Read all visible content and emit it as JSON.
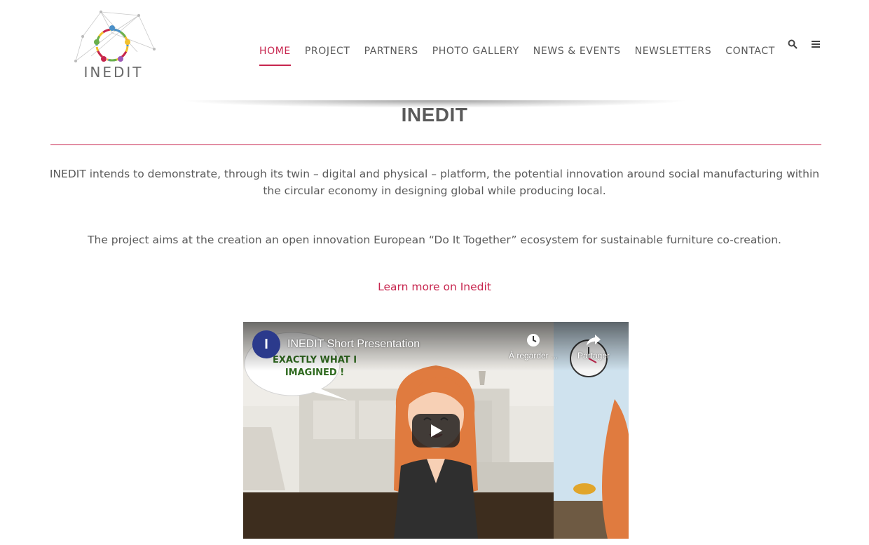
{
  "header": {
    "logo_text": "INEDIT",
    "nav": [
      {
        "label": "HOME",
        "active": true
      },
      {
        "label": "PROJECT",
        "active": false
      },
      {
        "label": "PARTNERS",
        "active": false
      },
      {
        "label": "PHOTO GALLERY",
        "active": false
      },
      {
        "label": "NEWS & EVENTS",
        "active": false
      },
      {
        "label": "NEWSLETTERS",
        "active": false
      },
      {
        "label": "CONTACT",
        "active": false
      }
    ],
    "icons": {
      "search": "search-icon",
      "menu": "menu-icon"
    }
  },
  "main": {
    "title": "INEDIT",
    "paragraph1": "INEDIT intends to demonstrate, through its twin – digital and physical – platform, the potential innovation around social manufacturing within the circular economy in designing global while producing local.",
    "paragraph2": "The project aims at the creation an open innovation European “Do It Together” ecosystem for sustainable furniture co-creation.",
    "learn_more": "Learn more on Inedit"
  },
  "video": {
    "channel_initial": "I",
    "title": "INEDIT Short Presentation",
    "watch_later": "À regarder ...",
    "share": "Partager",
    "bubble_text": "EXACTLY WHAT I IMAGINED !"
  },
  "colors": {
    "accent": "#c7254e",
    "text": "#5a5a5a",
    "video_channel": "#2b3a8c",
    "bubble_text": "#2f6a1f"
  }
}
